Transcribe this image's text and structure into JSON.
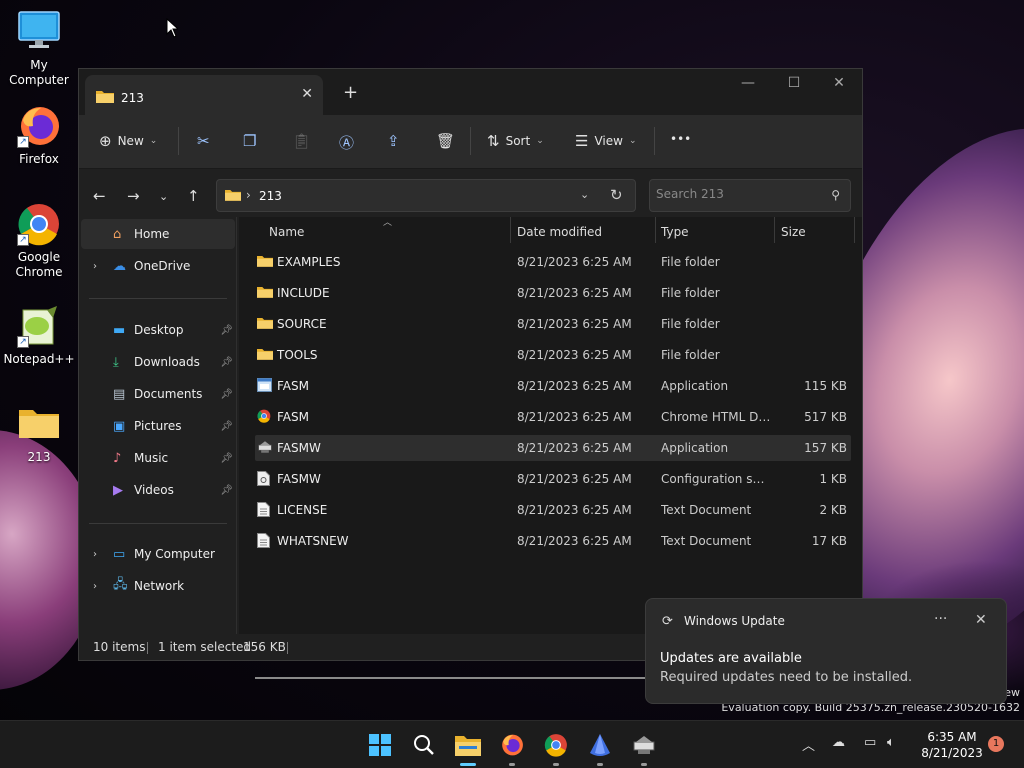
{
  "desktop": {
    "icons": [
      {
        "label": "My Computer"
      },
      {
        "label": "Firefox"
      },
      {
        "label": "Google Chrome"
      },
      {
        "label": "Notepad++"
      },
      {
        "label": "213"
      }
    ]
  },
  "explorer": {
    "tab_title": "213",
    "toolbar": {
      "new_label": "New",
      "sort_label": "Sort",
      "view_label": "View",
      "more_label": "•••"
    },
    "address": {
      "crumb": "213",
      "separator": "›"
    },
    "search": {
      "placeholder": "Search 213"
    },
    "sidebar": {
      "items": [
        {
          "label": "Home",
          "selected": true
        },
        {
          "label": "OneDrive"
        },
        {
          "label": "Desktop",
          "pinned": true
        },
        {
          "label": "Downloads",
          "pinned": true
        },
        {
          "label": "Documents",
          "pinned": true
        },
        {
          "label": "Pictures",
          "pinned": true
        },
        {
          "label": "Music",
          "pinned": true
        },
        {
          "label": "Videos",
          "pinned": true
        },
        {
          "label": "My Computer"
        },
        {
          "label": "Network"
        }
      ]
    },
    "columns": {
      "name": "Name",
      "date": "Date modified",
      "type": "Type",
      "size": "Size"
    },
    "files": [
      {
        "name": "EXAMPLES",
        "date": "8/21/2023 6:25 AM",
        "type": "File folder",
        "size": "",
        "icon": "folder-icon"
      },
      {
        "name": "INCLUDE",
        "date": "8/21/2023 6:25 AM",
        "type": "File folder",
        "size": "",
        "icon": "folder-icon"
      },
      {
        "name": "SOURCE",
        "date": "8/21/2023 6:25 AM",
        "type": "File folder",
        "size": "",
        "icon": "folder-icon"
      },
      {
        "name": "TOOLS",
        "date": "8/21/2023 6:25 AM",
        "type": "File folder",
        "size": "",
        "icon": "folder-icon"
      },
      {
        "name": "FASM",
        "date": "8/21/2023 6:25 AM",
        "type": "Application",
        "size": "115 KB",
        "icon": "application-icon"
      },
      {
        "name": "FASM",
        "date": "8/21/2023 6:25 AM",
        "type": "Chrome HTML Do...",
        "size": "517 KB",
        "icon": "chrome-html-icon"
      },
      {
        "name": "FASMW",
        "date": "8/21/2023 6:25 AM",
        "type": "Application",
        "size": "157 KB",
        "icon": "fasmw-app-icon",
        "selected": true
      },
      {
        "name": "FASMW",
        "date": "8/21/2023 6:25 AM",
        "type": "Configuration sett...",
        "size": "1 KB",
        "icon": "config-file-icon"
      },
      {
        "name": "LICENSE",
        "date": "8/21/2023 6:25 AM",
        "type": "Text Document",
        "size": "2 KB",
        "icon": "text-file-icon"
      },
      {
        "name": "WHATSNEW",
        "date": "8/21/2023 6:25 AM",
        "type": "Text Document",
        "size": "17 KB",
        "icon": "text-file-icon"
      }
    ],
    "status": {
      "count": "10 items",
      "selection": "1 item selected",
      "size": "156 KB"
    }
  },
  "notification": {
    "app": "Windows Update",
    "more": "···",
    "title": "Updates are available",
    "body": "Required updates need to be installed."
  },
  "watermark": {
    "line1": "ew",
    "line2": "Evaluation copy. Build 25375.zn_release.230520-1632"
  },
  "taskbar": {
    "time": "6:35 AM",
    "date": "8/21/2023",
    "badge": "1"
  },
  "colors": {
    "accent": "#60cdff",
    "folder": "#f5c84c",
    "badge": "#e8775d"
  }
}
